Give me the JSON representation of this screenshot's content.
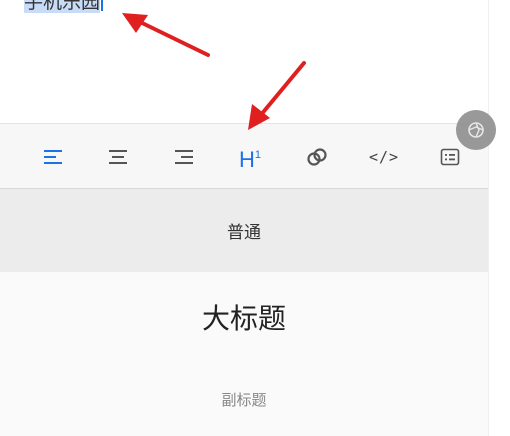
{
  "editor": {
    "text": "手机乐园"
  },
  "toolbar": {
    "heading_label": "H",
    "heading_superscript": "1",
    "code_label": "</>"
  },
  "format_menu": {
    "normal": "普通",
    "heading1": "大标题",
    "heading2": "副标题"
  },
  "colors": {
    "accent": "#1a73e8",
    "icon": "#555555",
    "arrow": "#e02020"
  },
  "icons": [
    "align-left-icon",
    "align-center-icon",
    "align-right-icon",
    "heading-icon",
    "link-icon",
    "code-icon",
    "list-icon",
    "floating-action-icon"
  ]
}
